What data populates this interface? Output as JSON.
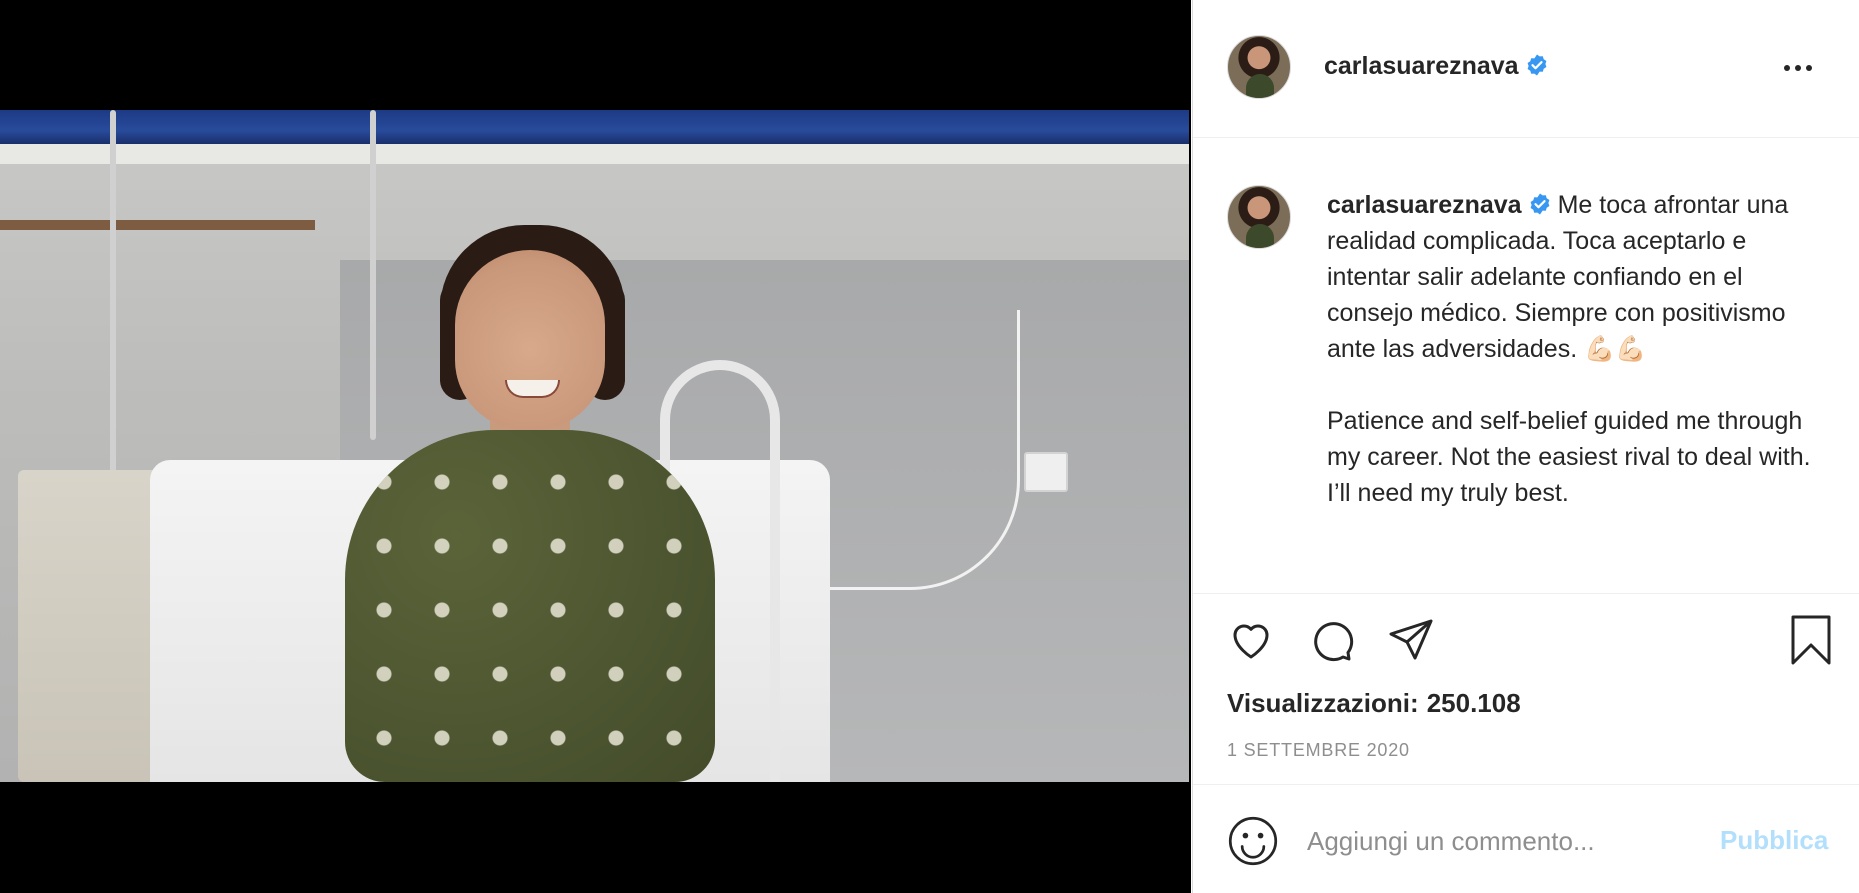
{
  "post": {
    "username": "carlasuareznava",
    "caption": "Me toca afrontar una realidad complicada. Toca aceptarlo e intentar salir adelante confiando en el consejo médico. Siempre con positivismo ante las adversidades. 💪🏻💪🏻\n\nPatience and self-belief guided me through my career. Not the easiest rival to deal with. I’ll need my truly best.",
    "views_label": "Visualizzazioni:",
    "views_value": "250.108",
    "date": "1 settembre 2020"
  },
  "comment": {
    "placeholder": "Aggiungi un commento...",
    "post_label": "Pubblica"
  },
  "icons": {
    "verified": "verified-badge-icon",
    "more": "more-options-icon",
    "like": "heart-icon",
    "comment": "comment-icon",
    "share": "paper-plane-icon",
    "save": "bookmark-icon",
    "emoji": "smiley-icon",
    "mute": "speaker-muted-icon"
  },
  "colors": {
    "verified_blue": "#3897f0",
    "post_button_disabled": "#b2dffc",
    "secondary_text": "#8e8e8e"
  }
}
